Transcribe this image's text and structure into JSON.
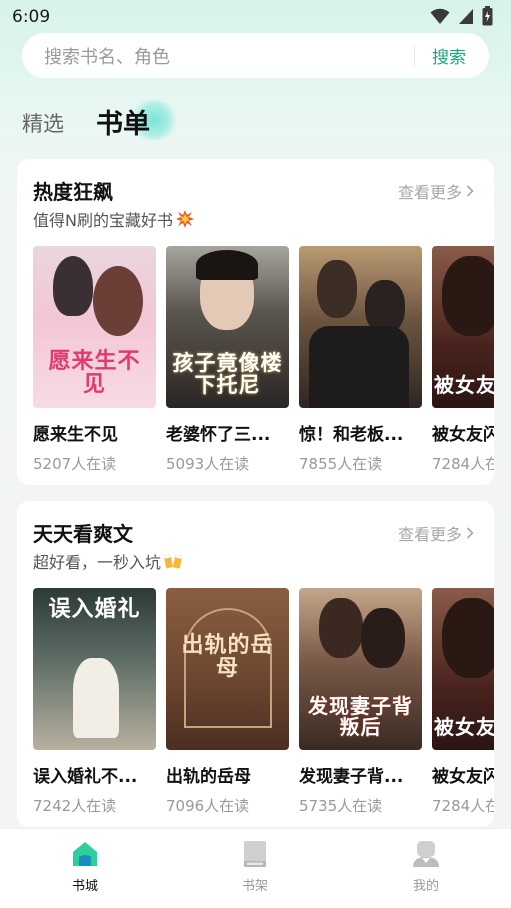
{
  "status": {
    "time": "6:09"
  },
  "search": {
    "placeholder": "搜索书名、角色",
    "button": "搜索"
  },
  "tabs": [
    {
      "label": "精选"
    },
    {
      "label": "书单"
    }
  ],
  "sections": [
    {
      "title": "热度狂飙",
      "more": "查看更多",
      "subtitle": "值得N刷的宝藏好书",
      "subtitle_emoji": "collision",
      "books": [
        {
          "title": "愿来生不见",
          "readers": "5207人在读",
          "cover_text": "愿来生不见",
          "cover_color": "#f4c7d6"
        },
        {
          "title": "老婆怀了三...",
          "readers": "5093人在读",
          "cover_text": "孩子竟像楼下托尼",
          "cover_color": "#3c3a3a"
        },
        {
          "title": "惊！和老板...",
          "readers": "7855人在读",
          "cover_text": "",
          "cover_color": "#5a4a3a"
        },
        {
          "title": "被女友闪",
          "readers": "7284人在",
          "cover_text": "被女友闪婚",
          "cover_color": "#5e2a22"
        }
      ]
    },
    {
      "title": "天天看爽文",
      "more": "查看更多",
      "subtitle": "超好看，一秒入坑",
      "subtitle_emoji": "beers",
      "books": [
        {
          "title": "误入婚礼不...",
          "readers": "7242人在读",
          "cover_text": "误入婚礼",
          "cover_color": "#3c4a46"
        },
        {
          "title": "出轨的岳母",
          "readers": "7096人在读",
          "cover_text": "出轨的岳母",
          "cover_color": "#7a5238"
        },
        {
          "title": "发现妻子背...",
          "readers": "5735人在读",
          "cover_text": "发现妻子背叛后",
          "cover_color": "#6a4b3e"
        },
        {
          "title": "被女友闪",
          "readers": "7284人在",
          "cover_text": "被女友闪婚",
          "cover_color": "#5e2a22"
        }
      ]
    }
  ],
  "nav": [
    {
      "label": "书城",
      "icon": "bookstore-icon",
      "active": true
    },
    {
      "label": "书架",
      "icon": "bookshelf-icon",
      "active": false
    },
    {
      "label": "我的",
      "icon": "profile-icon",
      "active": false
    }
  ],
  "colors": {
    "accent": "#1aa67c",
    "background_top": "#d7f3ea"
  }
}
